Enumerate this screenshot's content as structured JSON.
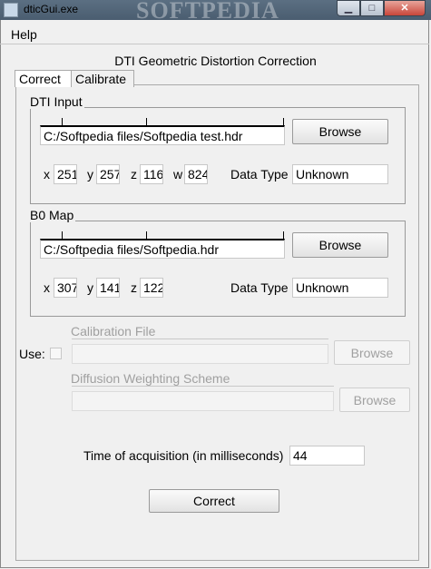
{
  "window": {
    "title": "dticGui.exe",
    "watermark": "SOFTPEDIA",
    "minimize_glyph": "▁",
    "maximize_glyph": "□",
    "close_glyph": "✕"
  },
  "menu": {
    "help": "Help"
  },
  "app_title": "DTI Geometric Distortion Correction",
  "tabs": [
    {
      "label": "Correct",
      "selected": true
    },
    {
      "label": "Calibrate",
      "selected": false
    }
  ],
  "dti_input": {
    "label": "DTI Input",
    "path": "C:/Softpedia files/Softpedia test.hdr",
    "browse": "Browse",
    "x_label": "x",
    "x": "251",
    "y_label": "y",
    "y": "257",
    "z_label": "z",
    "z": "116",
    "w_label": "w",
    "w": "824",
    "data_type_label": "Data Type",
    "data_type": "Unknown"
  },
  "b0_map": {
    "label": "B0 Map",
    "path": "C:/Softpedia files/Softpedia.hdr",
    "browse": "Browse",
    "x_label": "x",
    "x": "307",
    "y_label": "y",
    "y": "141",
    "z_label": "z",
    "z": "122",
    "data_type_label": "Data Type",
    "data_type": "Unknown"
  },
  "calibration": {
    "use_label": "Use:",
    "use_checked": false,
    "calibration_file_label": "Calibration File",
    "calibration_browse": "Browse",
    "diffusion_label": "Diffusion Weighting Scheme",
    "diffusion_browse": "Browse"
  },
  "acquisition": {
    "label": "Time of acquisition (in milliseconds)",
    "value": "44"
  },
  "correct_button": "Correct"
}
